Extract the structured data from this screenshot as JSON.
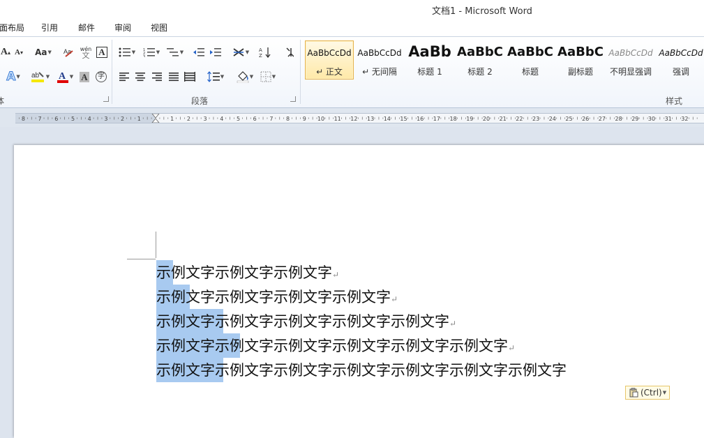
{
  "window": {
    "title": "文档1 - Microsoft Word"
  },
  "tabs": [
    "面布局",
    "引用",
    "邮件",
    "审阅",
    "视图"
  ],
  "ribbon": {
    "groups": {
      "font": "体",
      "paragraph": "段落",
      "styles": "样式"
    },
    "styles": [
      {
        "sample": "AaBbCcDd",
        "name": "↵ 正文",
        "selected": true
      },
      {
        "sample": "AaBbCcDd",
        "name": "↵ 无间隔"
      },
      {
        "sample": "AaBb",
        "name": "标题 1"
      },
      {
        "sample": "AaBbC",
        "name": "标题 2"
      },
      {
        "sample": "AaBbC",
        "name": "标题"
      },
      {
        "sample": "AaBbC",
        "name": "副标题"
      },
      {
        "sample": "AaBbCcDd",
        "name": "不明显强调"
      },
      {
        "sample": "AaBbCcDd",
        "name": "强调"
      }
    ],
    "font_buttons": {
      "case": "Aa",
      "wen": "wén",
      "zi": "字",
      "char_border": "A"
    }
  },
  "ruler": {
    "left_labels": [
      "8",
      "7",
      "6",
      "5",
      "4",
      "3",
      "2",
      "1"
    ],
    "right_labels": [
      "1",
      "2",
      "3",
      "4",
      "5",
      "6",
      "7",
      "8",
      "9",
      "10",
      "11",
      "12",
      "13",
      "14",
      "15",
      "16",
      "17",
      "18",
      "19",
      "20",
      "21",
      "22",
      "23",
      "24",
      "25",
      "26",
      "27",
      "28",
      "29",
      "30",
      "31",
      "32"
    ]
  },
  "document": {
    "lines": [
      "示例文字示例文字示例文字",
      "示例文字示例文字示例文字示例文字",
      "示例文字示例文字示例文字示例文字示例文字",
      "示例文字示例文字示例文字示例文字示例文字示例文字",
      "示例文字示例文字示例文字示例文字示例文字示例文字示例文字"
    ],
    "para_mark": "↵",
    "paste_options": "(Ctrl)"
  }
}
